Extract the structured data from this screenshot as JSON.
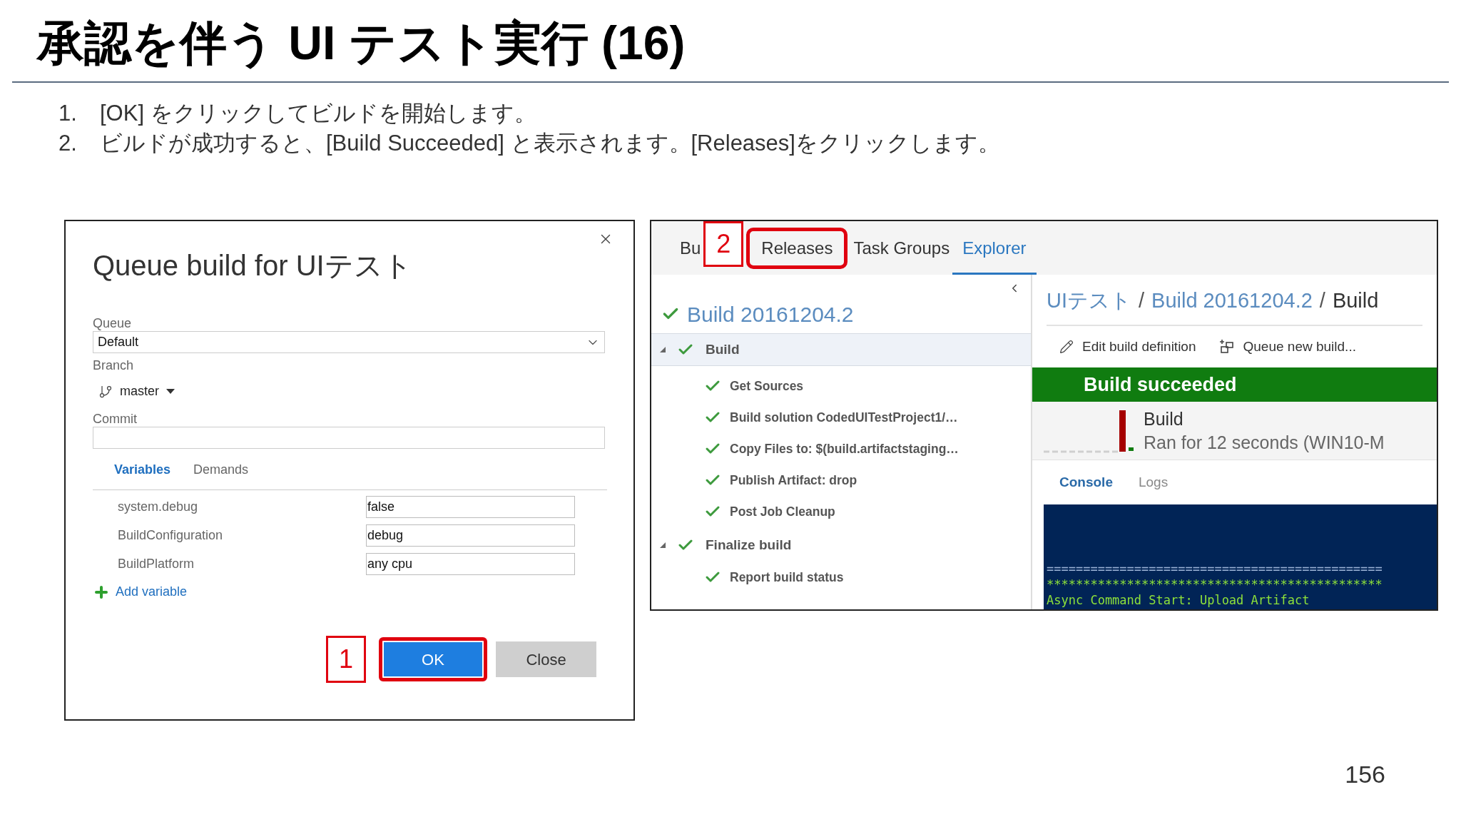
{
  "slide": {
    "title": "承認を伴う UI テスト実行 (16)",
    "steps": [
      {
        "number": "1.",
        "text": "[OK] をクリックしてビルドを開始します。"
      },
      {
        "number": "2.",
        "text": "ビルドが成功すると、[Build Succeeded] と表示されます。[Releases]をクリックします。"
      }
    ],
    "page_number": "156"
  },
  "dialog": {
    "title": "Queue build for UIテスト",
    "queue": {
      "label": "Queue",
      "value": "Default"
    },
    "branch": {
      "label": "Branch",
      "value": "master"
    },
    "commit": {
      "label": "Commit"
    },
    "tabs": [
      {
        "label": "Variables",
        "selected": true
      },
      {
        "label": "Demands",
        "selected": false
      }
    ],
    "variables": [
      {
        "name": "system.debug",
        "value": "false"
      },
      {
        "name": "BuildConfiguration",
        "value": "debug"
      },
      {
        "name": "BuildPlatform",
        "value": "any cpu"
      }
    ],
    "add_variable": "Add variable",
    "callout": "1",
    "buttons": [
      {
        "label": "OK",
        "kind": "primary",
        "highlighted": true
      },
      {
        "label": "Close",
        "kind": "secondary",
        "highlighted": false
      }
    ]
  },
  "build_view": {
    "tabs": [
      {
        "label": "Bu",
        "selected": false,
        "highlighted": false,
        "callout": "2"
      },
      {
        "label": "Releases",
        "selected": false,
        "highlighted": true
      },
      {
        "label": "Task Groups",
        "selected": false,
        "highlighted": false
      },
      {
        "label": "Explorer",
        "selected": true,
        "highlighted": false
      }
    ],
    "tree": {
      "title": "Build 20161204.2",
      "items": [
        {
          "label": "Build",
          "expanded": true,
          "selected": true,
          "children": [
            {
              "label": "Get Sources"
            },
            {
              "label": "Build solution CodedUITestProject1/…"
            },
            {
              "label": "Copy Files to: $(build.artifactstaging…"
            },
            {
              "label": "Publish Artifact: drop"
            },
            {
              "label": "Post Job Cleanup"
            }
          ]
        },
        {
          "label": "Finalize build",
          "expanded": true,
          "selected": false,
          "children": [
            {
              "label": "Report build status"
            }
          ]
        }
      ]
    },
    "breadcrumb": {
      "separator": "/",
      "items": [
        {
          "label": "UIテスト",
          "current": false
        },
        {
          "label": "Build 20161204.2",
          "current": false
        },
        {
          "label": "Build",
          "current": true
        }
      ]
    },
    "actions": [
      {
        "label": "Edit build definition",
        "kind": "edit"
      },
      {
        "label": "Queue new build...",
        "kind": "queue"
      }
    ],
    "banner": "Build succeeded",
    "job": {
      "name": "Build",
      "summary": "Ran for 12 seconds (WIN10-M"
    },
    "console_tabs": [
      {
        "label": "Console",
        "selected": true
      },
      {
        "label": "Logs",
        "selected": false
      }
    ],
    "console_lines": [
      "==============================================",
      "**********************************************",
      "Async Command Start: Upload Artifact"
    ]
  }
}
